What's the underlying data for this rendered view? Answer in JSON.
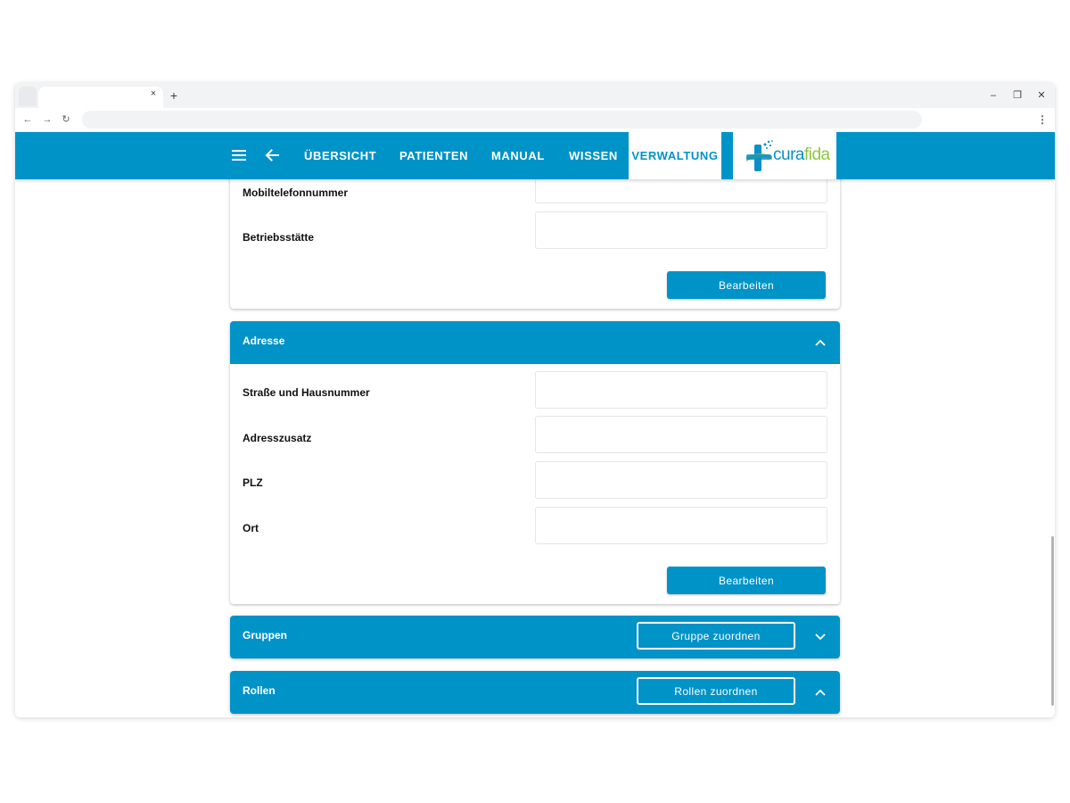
{
  "browser": {
    "tab_close": "×",
    "new_tab": "+",
    "minimize": "–",
    "restore": "❐",
    "close": "✕",
    "back": "←",
    "forward": "→",
    "reload": "↻",
    "menu": "⋮"
  },
  "appbar": {
    "nav": [
      "ÜBERSICHT",
      "PATIENTEN",
      "MANUAL",
      "WISSEN",
      "VERWALTUNG"
    ],
    "active": "VERWALTUNG",
    "logo": {
      "part1": "cura",
      "part2": "fida"
    },
    "colors": {
      "primary": "#0093c8",
      "logo_blue": "#0a8fc7",
      "logo_green": "#8cc63f"
    }
  },
  "contact_card": {
    "rows": [
      "Mobiltelefonnummer",
      "Betriebsstätte"
    ],
    "button": "Bearbeiten"
  },
  "address_card": {
    "title": "Adresse",
    "rows": [
      "Straße und Hausnummer",
      "Adresszusatz",
      "PLZ",
      "Ort"
    ],
    "button": "Bearbeiten"
  },
  "groups_card": {
    "title": "Gruppen",
    "button": "Gruppe zuordnen"
  },
  "roles_card": {
    "title": "Rollen",
    "button": "Rollen zuordnen"
  }
}
